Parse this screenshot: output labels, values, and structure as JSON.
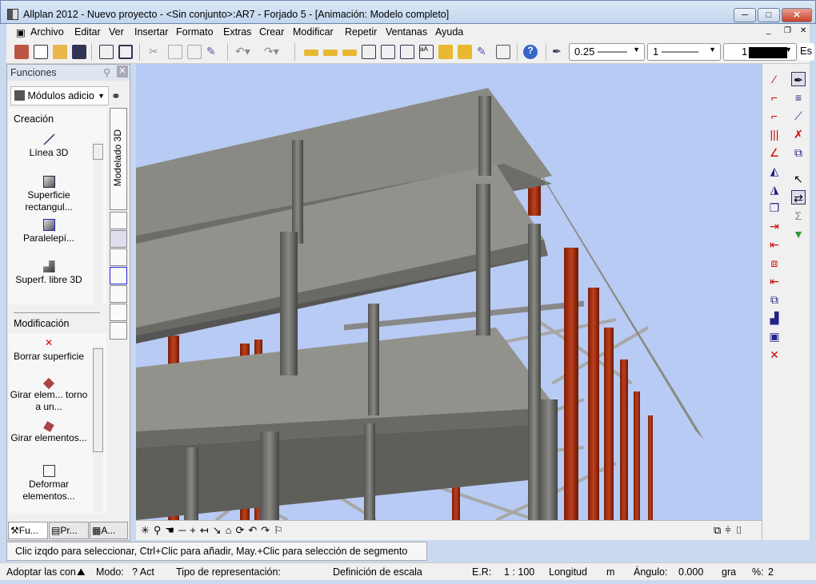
{
  "window": {
    "title": "Allplan 2012 - Nuevo proyecto - <Sin conjunto>:AR7 - Forjado 5 - [Animación: Modelo completo]",
    "min": "─",
    "max": "□",
    "close": "✕"
  },
  "menu": [
    "Archivo",
    "Editar",
    "Ver",
    "Insertar",
    "Formato",
    "Extras",
    "Crear",
    "Modificar",
    "Repetir",
    "Ventanas",
    "Ayuda"
  ],
  "toolbar": {
    "pen_thickness": "0.25",
    "line_type": "1",
    "color": "1",
    "extra": "Es"
  },
  "panel": {
    "title": "Funciones",
    "module_select": "Módulos adicio",
    "vertical_tab": "Modelado 3D",
    "section_create": "Creación",
    "section_modify": "Modificación",
    "create_items": [
      "Línea 3D",
      "Superficie rectangul...",
      "Paralelepí...",
      "Superf. libre 3D"
    ],
    "modify_items": [
      "Borrar superficie",
      "Girar elem... torno a un...",
      "Girar elementos...",
      "Deformar elementos..."
    ],
    "bottom_tabs": [
      "Fu...",
      "Pr...",
      "A..."
    ]
  },
  "hint": "Clic izqdo para seleccionar, Ctrl+Clic para añadir, May.+Clic para selección de segmento",
  "status": {
    "adopt": "Adoptar las con",
    "mode": "Modo:",
    "mode_val": "? Act",
    "repr": "Tipo de representación:",
    "scale_def": "Definición de escala",
    "er": "E.R:",
    "er_val": "1 : 100",
    "length": "Longitud",
    "length_unit": "m",
    "angle": "Ángulo:",
    "angle_val": "0.000",
    "angle_unit": "gra",
    "pct": "%:",
    "pct_val": "2"
  },
  "colors": {
    "viewport": "#b8cbf4",
    "concrete": "#7a7a74",
    "steel": "#a83418"
  }
}
